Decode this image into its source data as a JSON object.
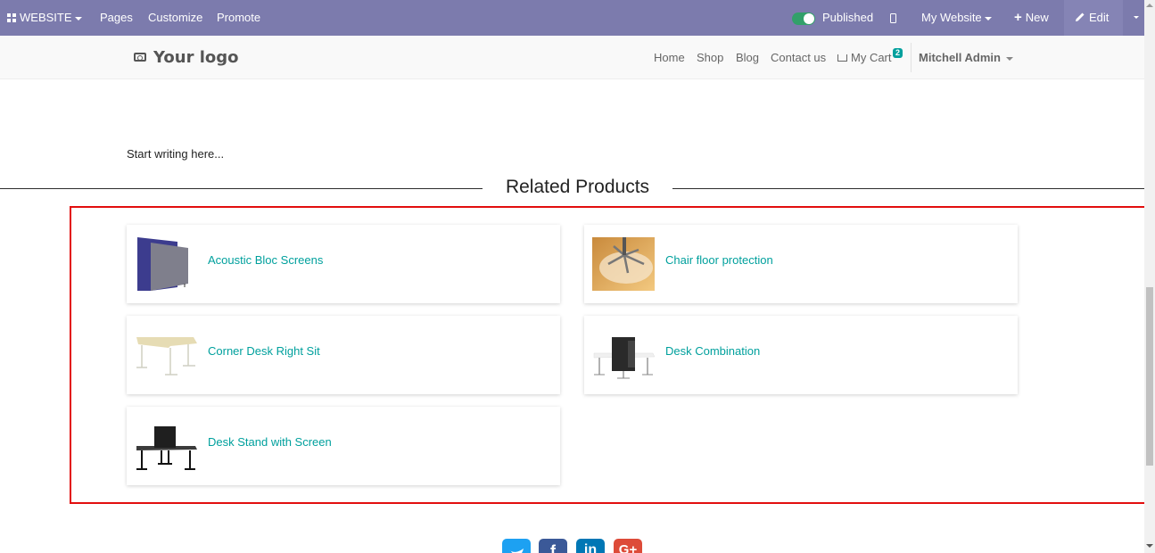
{
  "adminbar": {
    "website_label": "WEBSITE",
    "pages_label": "Pages",
    "customize_label": "Customize",
    "promote_label": "Promote",
    "published_label": "Published",
    "my_website_label": "My Website",
    "new_label": "New",
    "edit_label": "Edit",
    "colors": {
      "bar": "#7c7bad",
      "toggle": "#32a06a"
    }
  },
  "header": {
    "logo_text": "Your logo",
    "nav": {
      "home": "Home",
      "shop": "Shop",
      "blog": "Blog",
      "contact": "Contact us",
      "cart": "My Cart"
    },
    "cart_count": "2",
    "user": "Mitchell Admin"
  },
  "content": {
    "placeholder": "Start writing here...",
    "related_title": "Related Products",
    "products": [
      {
        "name": "Acoustic Bloc Screens",
        "image": "blue-acoustic-screen"
      },
      {
        "name": "Chair floor protection",
        "image": "chair-floor-mat"
      },
      {
        "name": "Corner Desk Right Sit",
        "image": "corner-desk"
      },
      {
        "name": "Desk Combination",
        "image": "desk-combination"
      },
      {
        "name": "Desk Stand with Screen",
        "image": "desk-stand-screen"
      }
    ],
    "accent_color": "#00a09d",
    "highlight_color": "#e20e0e"
  },
  "footer": {
    "social_icons": [
      "twitter-icon",
      "facebook-icon",
      "linkedin-icon",
      "google-plus-icon"
    ]
  }
}
